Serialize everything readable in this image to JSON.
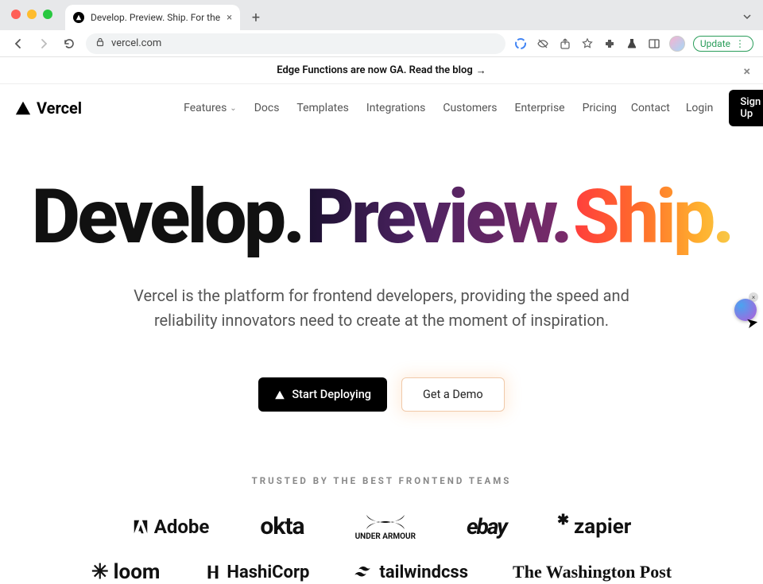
{
  "browser": {
    "tab_title": "Develop. Preview. Ship. For the",
    "url": "vercel.com",
    "update_label": "Update"
  },
  "announce": {
    "text": "Edge Functions are now GA. Read the blog",
    "arrow": "→"
  },
  "header": {
    "logo_text": "Vercel",
    "nav": {
      "features": "Features",
      "docs": "Docs",
      "templates": "Templates",
      "integrations": "Integrations",
      "customers": "Customers",
      "enterprise": "Enterprise",
      "pricing": "Pricing"
    },
    "right": {
      "contact": "Contact",
      "login": "Login",
      "signup": "Sign Up"
    }
  },
  "hero": {
    "word_develop": "Develop.",
    "word_preview": "Preview.",
    "word_ship": "Ship.",
    "subtitle": "Vercel is the platform for frontend developers, providing the speed and reliability innovators need to create at the moment of inspiration.",
    "cta_primary": "Start Deploying",
    "cta_secondary": "Get a Demo"
  },
  "trusted": {
    "label": "TRUSTED BY THE BEST FRONTEND TEAMS",
    "row1": {
      "adobe": "Adobe",
      "okta": "okta",
      "ua_small": "UNDER ARMOUR",
      "ebay": "ebay",
      "zapier": "zapier"
    },
    "row2": {
      "loom": "loom",
      "hashicorp": "HashiCorp",
      "tailwind": "tailwindcss",
      "wapo": "The Washington Post"
    }
  }
}
